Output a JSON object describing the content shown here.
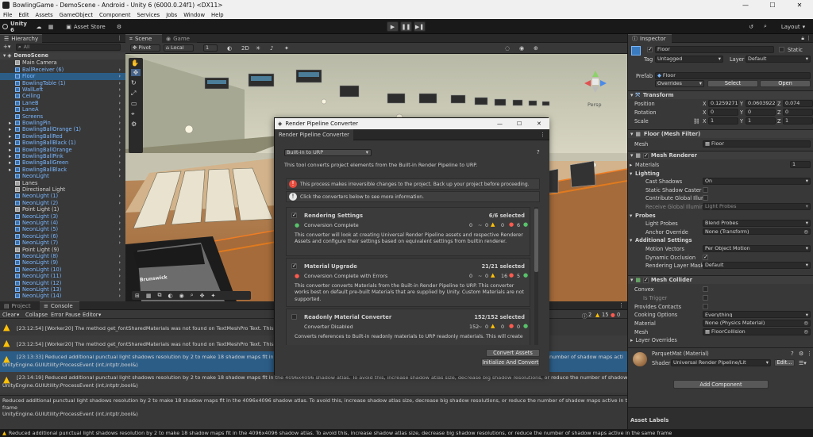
{
  "window": {
    "title": "BowlingGame - DemoScene - Android - Unity 6 (6000.0.24f1) <DX11>",
    "controls": [
      "—",
      "☐",
      "✕"
    ]
  },
  "menu": [
    "File",
    "Edit",
    "Assets",
    "GameObject",
    "Component",
    "Services",
    "Jobs",
    "Window",
    "Help"
  ],
  "toolbar": {
    "account": "Unity 6",
    "asset_store": "Asset Store",
    "layout": "Layout"
  },
  "hierarchy": {
    "tab": "Hierarchy",
    "search_placeholder": "All",
    "scene": "DemoScene",
    "items": [
      {
        "label": "Main Camera",
        "kind": "obj",
        "color": "white",
        "indent": 2
      },
      {
        "label": "BallReceiver (6)",
        "kind": "prefab",
        "color": "blue",
        "indent": 2
      },
      {
        "label": "Floor",
        "kind": "prefab",
        "color": "blue",
        "indent": 2,
        "selected": true
      },
      {
        "label": "BowlingTable (1)",
        "kind": "prefab",
        "color": "blue",
        "indent": 2
      },
      {
        "label": "WallLeft",
        "kind": "prefab",
        "color": "blue",
        "indent": 2
      },
      {
        "label": "Ceiling",
        "kind": "prefab",
        "color": "blue",
        "indent": 2
      },
      {
        "label": "LaneB",
        "kind": "prefab",
        "color": "blue",
        "indent": 2
      },
      {
        "label": "LaneA",
        "kind": "prefab",
        "color": "blue",
        "indent": 2
      },
      {
        "label": "Screens",
        "kind": "prefab",
        "color": "blue",
        "indent": 2
      },
      {
        "label": "BowlingPin",
        "kind": "prefab",
        "color": "blue",
        "indent": 2,
        "expand": true
      },
      {
        "label": "BowlingBallOrange (1)",
        "kind": "prefab",
        "color": "blue",
        "indent": 2,
        "expand": true
      },
      {
        "label": "BowlingBallRed",
        "kind": "prefab",
        "color": "blue",
        "indent": 2,
        "expand": true
      },
      {
        "label": "BowlingBallBlack (1)",
        "kind": "prefab",
        "color": "blue",
        "indent": 2,
        "expand": true
      },
      {
        "label": "BowlingBallOrange",
        "kind": "prefab",
        "color": "blue",
        "indent": 2,
        "expand": true
      },
      {
        "label": "BowlingBallPink",
        "kind": "prefab",
        "color": "blue",
        "indent": 2,
        "expand": true
      },
      {
        "label": "BowlingBallGreen",
        "kind": "prefab",
        "color": "blue",
        "indent": 2,
        "expand": true
      },
      {
        "label": "BowlingBallBlack",
        "kind": "prefab",
        "color": "blue",
        "indent": 2,
        "expand": true
      },
      {
        "label": "NeonLight",
        "kind": "prefab",
        "color": "blue",
        "indent": 2
      },
      {
        "label": "Lanes",
        "kind": "obj",
        "color": "white",
        "indent": 2
      },
      {
        "label": "Directional Light",
        "kind": "obj",
        "color": "white",
        "indent": 2
      },
      {
        "label": "NeonLight (1)",
        "kind": "prefab",
        "color": "blue",
        "indent": 2
      },
      {
        "label": "NeonLight (2)",
        "kind": "prefab",
        "color": "blue",
        "indent": 2
      },
      {
        "label": "Point Light (1)",
        "kind": "obj",
        "color": "white",
        "indent": 2
      },
      {
        "label": "NeonLight (3)",
        "kind": "prefab",
        "color": "blue",
        "indent": 2
      },
      {
        "label": "NeonLight (4)",
        "kind": "prefab",
        "color": "blue",
        "indent": 2
      },
      {
        "label": "NeonLight (5)",
        "kind": "prefab",
        "color": "blue",
        "indent": 2
      },
      {
        "label": "NeonLight (6)",
        "kind": "prefab",
        "color": "blue",
        "indent": 2
      },
      {
        "label": "NeonLight (7)",
        "kind": "prefab",
        "color": "blue",
        "indent": 2
      },
      {
        "label": "Point Light (9)",
        "kind": "obj",
        "color": "white",
        "indent": 2
      },
      {
        "label": "NeonLight (8)",
        "kind": "prefab",
        "color": "blue",
        "indent": 2
      },
      {
        "label": "NeonLight (9)",
        "kind": "prefab",
        "color": "blue",
        "indent": 2
      },
      {
        "label": "NeonLight (10)",
        "kind": "prefab",
        "color": "blue",
        "indent": 2
      },
      {
        "label": "NeonLight (11)",
        "kind": "prefab",
        "color": "blue",
        "indent": 2
      },
      {
        "label": "NeonLight (12)",
        "kind": "prefab",
        "color": "blue",
        "indent": 2
      },
      {
        "label": "NeonLight (13)",
        "kind": "prefab",
        "color": "blue",
        "indent": 2
      },
      {
        "label": "NeonLight (14)",
        "kind": "prefab",
        "color": "blue",
        "indent": 2
      }
    ]
  },
  "scene": {
    "tabs": [
      "Scene",
      "Game"
    ],
    "pivot": "Pivot",
    "local": "Local",
    "snap_value": "1",
    "view_mode": "2D",
    "persp": "Persp",
    "sign_text": "Brunswick"
  },
  "console": {
    "tabs": [
      "Project",
      "Console"
    ],
    "clear": "Clear",
    "collapse": "Collapse",
    "error_pause": "Error Pause",
    "editor": "Editor",
    "counts": {
      "warnings": "2",
      "errors": "15",
      "info": "0"
    },
    "messages": [
      {
        "kind": "warn",
        "line1": "[23:12:54] [Worker20] The method get_fontSharedMaterials was not found on TextMeshPro Text. This proje",
        "line2": ""
      },
      {
        "kind": "warn",
        "line1": "[23:12:54] [Worker20] The method get_fontSharedMaterials was not found on TextMeshPro Text. This proje",
        "line2": ""
      },
      {
        "kind": "warn",
        "line1": "[23:13:33] Reduced additional punctual light shadows resolution by 2 to make 18 shadow maps fit in the 40",
        "line1b": "number of shadow maps acti",
        "line2": "UnityEngine.GUIUtility:ProcessEvent (int,intptr,bool&)",
        "selected": true
      },
      {
        "kind": "warn",
        "line1": "[23:14:19] Reduced additional punctual light shadows resolution by 2 to make 18 shadow maps fit in the 4096x4096 shadow atlas. To avoid this, increase shadow atlas size, decrease big shadow resolutions, or reduce the number of shadow maps active in the same frame",
        "line2": "UnityEngine.GUIUtility:ProcessEvent (int,intptr,bool&)"
      }
    ],
    "detail": [
      "Reduced additional punctual light shadows resolution by 2 to make 18 shadow maps fit in the 4096x4096 shadow atlas. To avoid this, increase shadow atlas size, decrease big shadow resolutions, or reduce the number of shadow maps active in the same",
      "frame",
      "UnityEngine.GUIUtility:ProcessEvent (int,intptr,bool&)"
    ]
  },
  "status": "Reduced additional punctual light shadows resolution by 2 to make 18 shadow maps fit in the 4096x4096 shadow atlas. To avoid this, increase shadow atlas size, decrease big shadow resolutions, or reduce the number of shadow maps active in the same frame",
  "converter": {
    "window_title": "Render Pipeline Converter",
    "tab": "Render Pipeline Converter",
    "dropdown": "Built-in to URP",
    "description": "This tool converts project elements from the Built-in Render Pipeline to URP.",
    "warning": "This process makes irreversible changes to the project. Back up your project before proceeding.",
    "info": "Click the converters below to see more information.",
    "cards": [
      {
        "title": "Rendering Settings",
        "selected": "6/6 selected",
        "status": "Conversion Complete",
        "status_kind": "ok",
        "c0": "0",
        "c1": "0",
        "c2": "0",
        "c3": "6",
        "desc": "This converter will look at creating Universal Render Pipeline assets and respective Renderer Assets and configure their settings based on equivalent settings from builtin renderer."
      },
      {
        "title": "Material Upgrade",
        "selected": "21/21 selected",
        "status": "Conversion Complete with Errors",
        "status_kind": "err",
        "c0": "0",
        "c1": "0",
        "c2": "16",
        "c3": "5",
        "desc": "This converter converts Materials from the Built-in Render Pipeline to URP. This converter works best on default pre-built Materials that are supplied by Unity. Custom Materials are not supported."
      },
      {
        "title": "Readonly Material Converter",
        "selected": "152/152 selected",
        "status": "Converter Disabled",
        "status_kind": "none",
        "c0": "152",
        "c1": "0",
        "c2": "0",
        "c3": "0",
        "desc": "Converts references to Built-in readonly materials to URP readonly materials. This will create"
      }
    ],
    "convert_button": "Convert Assets",
    "init_button": "Initialize And Convert"
  },
  "inspector": {
    "tab": "Inspector",
    "name": "Floor",
    "static": "Static",
    "tag_label": "Tag",
    "tag": "Untagged",
    "layer_label": "Layer",
    "layer": "Default",
    "prefab_label": "Prefab",
    "prefab": "Floor",
    "overrides": "Overrides",
    "select": "Select",
    "open": "Open",
    "transform": {
      "title": "Transform",
      "position": {
        "label": "Position",
        "x": "0.1259271",
        "y": "0.0603922",
        "z": "0.074"
      },
      "rotation": {
        "label": "Rotation",
        "x": "0",
        "y": "0",
        "z": "0"
      },
      "scale": {
        "label": "Scale",
        "x": "1",
        "y": "1",
        "z": "1"
      }
    },
    "mesh_filter": {
      "title": "Floor (Mesh Filter)",
      "mesh_label": "Mesh",
      "mesh": "Floor"
    },
    "mesh_renderer": {
      "title": "Mesh Renderer",
      "materials_label": "Materials",
      "materials_count": "1",
      "lighting": "Lighting",
      "cast_shadows_label": "Cast Shadows",
      "cast_shadows": "On",
      "static_shadow_caster": "Static Shadow Caster",
      "contribute_gi": "Contribute Global Illumi",
      "receive_gi_label": "Receive Global Illuminati",
      "receive_gi": "Light Probes",
      "probes": "Probes",
      "light_probes_label": "Light Probes",
      "light_probes": "Blend Probes",
      "anchor_override_label": "Anchor Override",
      "anchor_override": "None (Transform)",
      "additional": "Additional Settings",
      "motion_vectors_label": "Motion Vectors",
      "motion_vectors": "Per Object Motion",
      "dynamic_occlusion": "Dynamic Occlusion",
      "rendering_layer_mask_label": "Rendering Layer Mask",
      "rendering_layer_mask": "Default"
    },
    "mesh_collider": {
      "title": "Mesh Collider",
      "convex": "Convex",
      "is_trigger": "Is Trigger",
      "provides_contacts": "Provides Contacts",
      "cooking_options_label": "Cooking Options",
      "cooking_options": "Everything",
      "material_label": "Material",
      "material": "None (Physics Material)",
      "mesh_label": "Mesh",
      "mesh": "FloorCollision"
    },
    "layer_overrides": "Layer Overrides",
    "material_asset": {
      "name": "ParquetMat (Material)",
      "shader_label": "Shader",
      "shader": "Universal Render Pipeline/Lit",
      "edit": "Edit..."
    },
    "add_component": "Add Component",
    "asset_labels": "Asset Labels"
  },
  "colors": {
    "accent": "#2c5d87",
    "prefab_blue": "#7ab7ff",
    "warning": "#ffc107",
    "error": "#ff5a4e",
    "ok": "#58c26a"
  }
}
